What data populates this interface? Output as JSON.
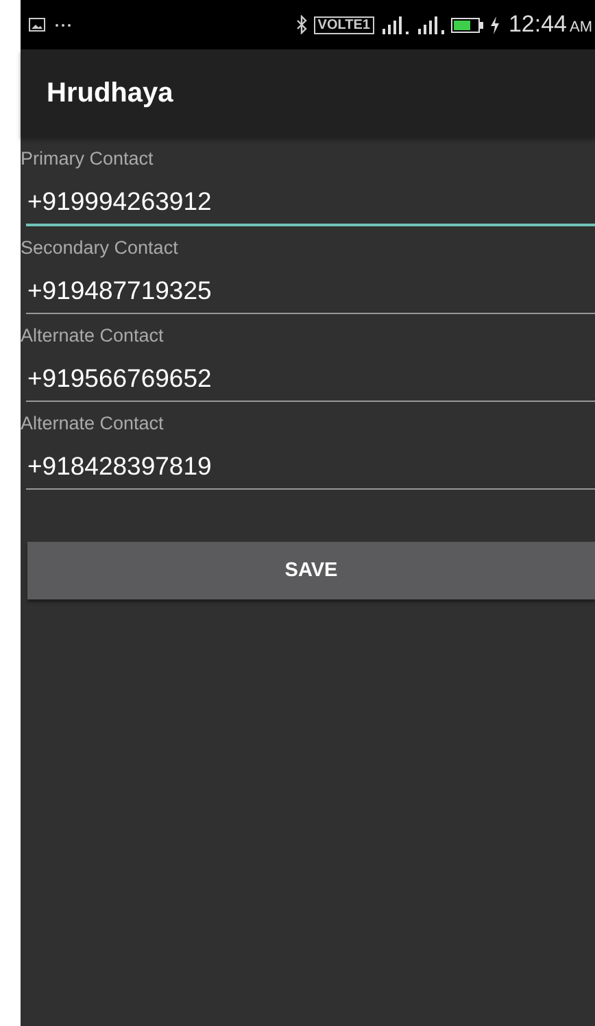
{
  "status_bar": {
    "network_badge": "VOLTE1",
    "time": "12:44",
    "meridiem": "AM"
  },
  "toolbar": {
    "title": "Hrudhaya"
  },
  "fields": [
    {
      "label": "Primary Contact",
      "value": "+919994263912",
      "focused": true
    },
    {
      "label": "Secondary Contact",
      "value": "+919487719325",
      "focused": false
    },
    {
      "label": "Alternate Contact",
      "value": "+919566769652",
      "focused": false
    },
    {
      "label": "Alternate Contact",
      "value": "+918428397819",
      "focused": false
    }
  ],
  "buttons": [
    {
      "label": "SAVE"
    }
  ]
}
